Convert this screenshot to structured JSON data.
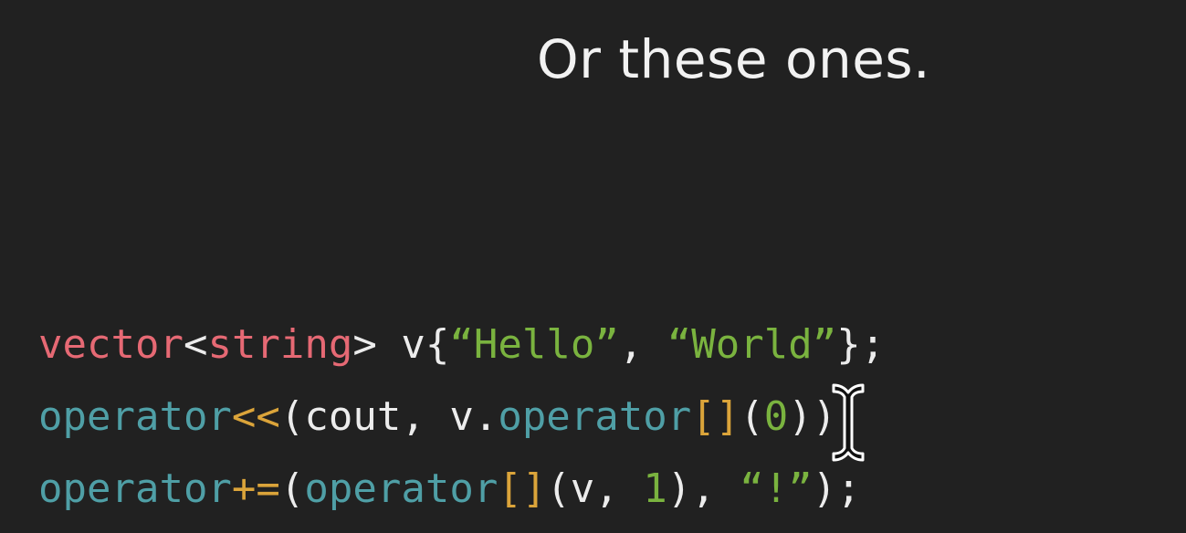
{
  "slide": {
    "title": "Or these ones."
  },
  "code": {
    "lines": [
      {
        "tokens": [
          {
            "text": "vector",
            "kind": "type"
          },
          {
            "text": "<",
            "kind": "plain"
          },
          {
            "text": "string",
            "kind": "type"
          },
          {
            "text": "> v{",
            "kind": "plain"
          },
          {
            "text": "“Hello”",
            "kind": "string"
          },
          {
            "text": ", ",
            "kind": "plain"
          },
          {
            "text": "“World”",
            "kind": "string"
          },
          {
            "text": "};",
            "kind": "plain"
          }
        ]
      },
      {
        "tokens": [
          {
            "text": "operator",
            "kind": "op-name"
          },
          {
            "text": "<<",
            "kind": "op-sym"
          },
          {
            "text": "(cout, v.",
            "kind": "plain"
          },
          {
            "text": "operator",
            "kind": "op-name"
          },
          {
            "text": "[]",
            "kind": "op-sym"
          },
          {
            "text": "(",
            "kind": "plain"
          },
          {
            "text": "0",
            "kind": "num"
          },
          {
            "text": "));",
            "kind": "plain"
          }
        ]
      },
      {
        "tokens": [
          {
            "text": "operator",
            "kind": "op-name"
          },
          {
            "text": "+=",
            "kind": "op-sym"
          },
          {
            "text": "(",
            "kind": "plain"
          },
          {
            "text": "operator",
            "kind": "op-name"
          },
          {
            "text": "[]",
            "kind": "op-sym"
          },
          {
            "text": "(v, ",
            "kind": "plain"
          },
          {
            "text": "1",
            "kind": "num"
          },
          {
            "text": "), ",
            "kind": "plain"
          },
          {
            "text": "“!”",
            "kind": "string"
          },
          {
            "text": ");",
            "kind": "plain"
          }
        ]
      }
    ]
  },
  "cursor": {
    "icon": "text-ibeam-cursor-icon"
  },
  "colors": {
    "background": "#212121",
    "title": "#f2f2f2",
    "type": "#e66974",
    "operator_name": "#4f9fa6",
    "operator_symbol": "#dba43a",
    "string_literal": "#7ab33f",
    "plain": "#ececec"
  }
}
